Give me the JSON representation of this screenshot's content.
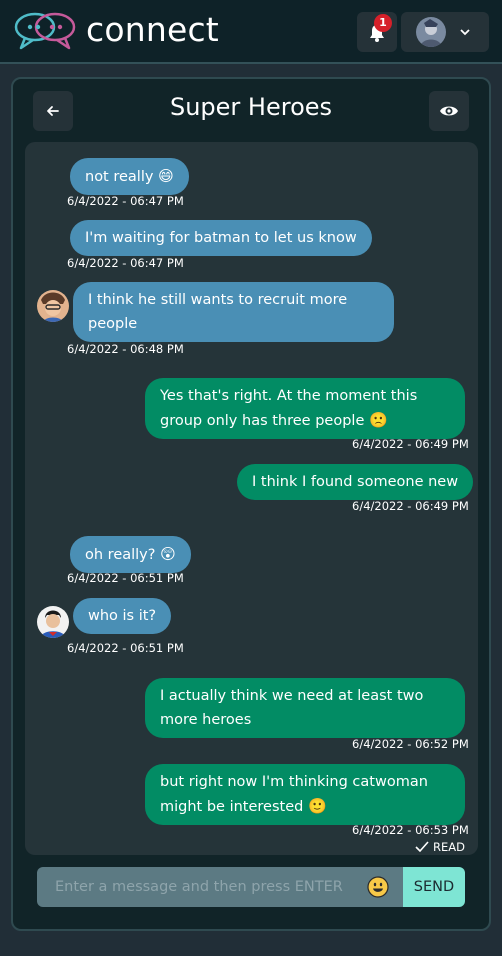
{
  "app": {
    "brand": "connect"
  },
  "navbar": {
    "notification_count": "1",
    "icons": {
      "notifications": "bell-icon",
      "profile_menu": "chevron-down-icon",
      "logo": "chat-bubbles-logo"
    }
  },
  "chat": {
    "title": "Super Heroes",
    "back_icon": "arrow-left-icon",
    "view_icon": "eye-icon",
    "messages": [
      {
        "text": "not really",
        "emoji": "😄",
        "time": "6/4/2022 - 06:47 PM",
        "direction": "incoming"
      },
      {
        "text": "I'm waiting for batman to let us know",
        "time": "6/4/2022 - 06:47 PM",
        "direction": "incoming"
      },
      {
        "text": "I think he still wants to recruit more people",
        "time": "6/4/2022 - 06:48 PM",
        "direction": "incoming"
      },
      {
        "text": "Yes that's right. At the moment this group only has three people",
        "emoji": "🙁",
        "time": "6/4/2022 - 06:49 PM",
        "direction": "outgoing"
      },
      {
        "text": "I think I found someone new",
        "time": "6/4/2022 - 06:49 PM",
        "direction": "outgoing"
      },
      {
        "text": "oh really?",
        "emoji": "😲",
        "time": "6/4/2022 - 06:51 PM",
        "direction": "incoming"
      },
      {
        "text": "who is it?",
        "time": "6/4/2022 - 06:51 PM",
        "direction": "incoming"
      },
      {
        "text": "I actually think we need at least two more heroes",
        "time": "6/4/2022 - 06:52 PM",
        "direction": "outgoing"
      },
      {
        "text": "but right now I'm thinking catwoman might be interested",
        "emoji": "🙂",
        "time": "6/4/2022 - 06:53 PM",
        "direction": "outgoing"
      }
    ],
    "read_label": "READ",
    "composer": {
      "placeholder": "Enter a message and then press ENTER",
      "send_label": "SEND",
      "emoji_icon": "smiley-icon"
    }
  },
  "colors": {
    "incoming_bubble": "#4a8fb5",
    "outgoing_bubble": "#028c64",
    "send_button": "#7ee5d4",
    "badge": "#d6202a"
  }
}
